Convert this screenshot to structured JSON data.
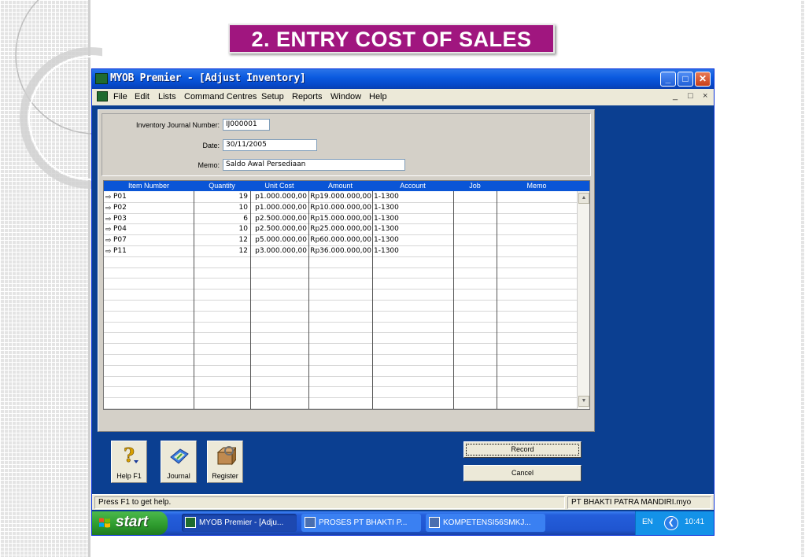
{
  "slide": {
    "title": "2. ENTRY COST OF SALES"
  },
  "window": {
    "title": "MYOB Premier - [Adjust Inventory]",
    "controls": {
      "minimize": "_",
      "maximize": "□",
      "close": "✕"
    }
  },
  "menu": {
    "items": [
      "File",
      "Edit",
      "Lists",
      "Command Centres",
      "Setup",
      "Reports",
      "Window",
      "Help"
    ],
    "mdi_controls": [
      "_",
      "□",
      "×"
    ]
  },
  "form": {
    "journal_number_label": "Inventory Journal Number:",
    "journal_number_value": "IJ000001",
    "date_label": "Date:",
    "date_value": "30/11/2005",
    "memo_label": "Memo:",
    "memo_value": "Saldo Awal Persediaan"
  },
  "table": {
    "columns": [
      "Item Number",
      "Quantity",
      "Unit Cost",
      "Amount",
      "Account",
      "Job",
      "Memo"
    ],
    "rows": [
      {
        "item": "P01",
        "qty": "19",
        "unit_cost": "p1.000.000,00",
        "amount": "Rp19.000.000,00",
        "account": "1-1300"
      },
      {
        "item": "P02",
        "qty": "10",
        "unit_cost": "p1.000.000,00",
        "amount": "Rp10.000.000,00",
        "account": "1-1300"
      },
      {
        "item": "P03",
        "qty": "6",
        "unit_cost": "p2.500.000,00",
        "amount": "Rp15.000.000,00",
        "account": "1-1300"
      },
      {
        "item": "P04",
        "qty": "10",
        "unit_cost": "p2.500.000,00",
        "amount": "Rp25.000.000,00",
        "account": "1-1300"
      },
      {
        "item": "P07",
        "qty": "12",
        "unit_cost": "p5.000.000,00",
        "amount": "Rp60.000.000,00",
        "account": "1-1300"
      },
      {
        "item": "P11",
        "qty": "12",
        "unit_cost": "p3.000.000,00",
        "amount": "Rp36.000.000,00",
        "account": "1-1300"
      }
    ]
  },
  "toolbar": {
    "help_label": "Help F1",
    "journal_label": "Journal",
    "register_label": "Register",
    "record_label": "Record",
    "cancel_label": "Cancel"
  },
  "status": {
    "left": "Press F1 to get help.",
    "right": "PT BHAKTI PATRA MANDIRI.myo"
  },
  "taskbar": {
    "start_label": "start",
    "tasks": [
      "MYOB Premier - [Adju...",
      "PROSES PT BHAKTI P...",
      "KOMPETENSI56SMKJ..."
    ],
    "language": "EN",
    "clock": "10:41"
  },
  "colors": {
    "slide_title_bg": "#a0167f",
    "window_bg": "#0b3f91",
    "table_header": "#0a55d6",
    "panel": "#d4d0c8"
  }
}
